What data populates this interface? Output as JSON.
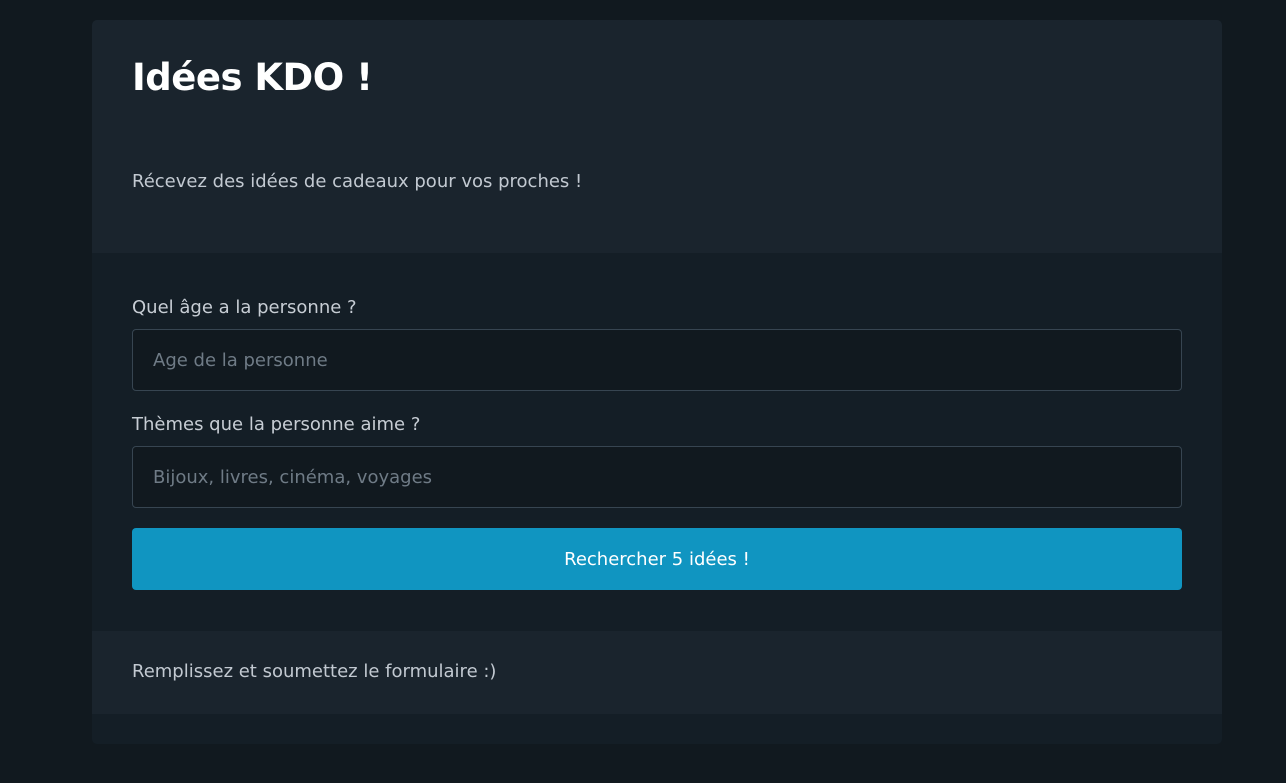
{
  "header": {
    "title": "Idées KDO !",
    "subtitle": "Récevez des idées de cadeaux pour vos proches !"
  },
  "form": {
    "age_label": "Quel âge a la personne ?",
    "age_value": "",
    "age_placeholder": "Age de la personne",
    "themes_label": "Thèmes que la personne aime ?",
    "themes_value": "",
    "themes_placeholder": "Bijoux, livres, cinéma, voyages",
    "submit_label": "Rechercher 5 idées !"
  },
  "footer": {
    "message": "Remplissez et soumettez le formulaire :)"
  },
  "colors": {
    "background": "#11191f",
    "card": "#141e26",
    "card_section": "#1a242d",
    "accent": "#1095c1",
    "text": "#c2c9d1"
  }
}
